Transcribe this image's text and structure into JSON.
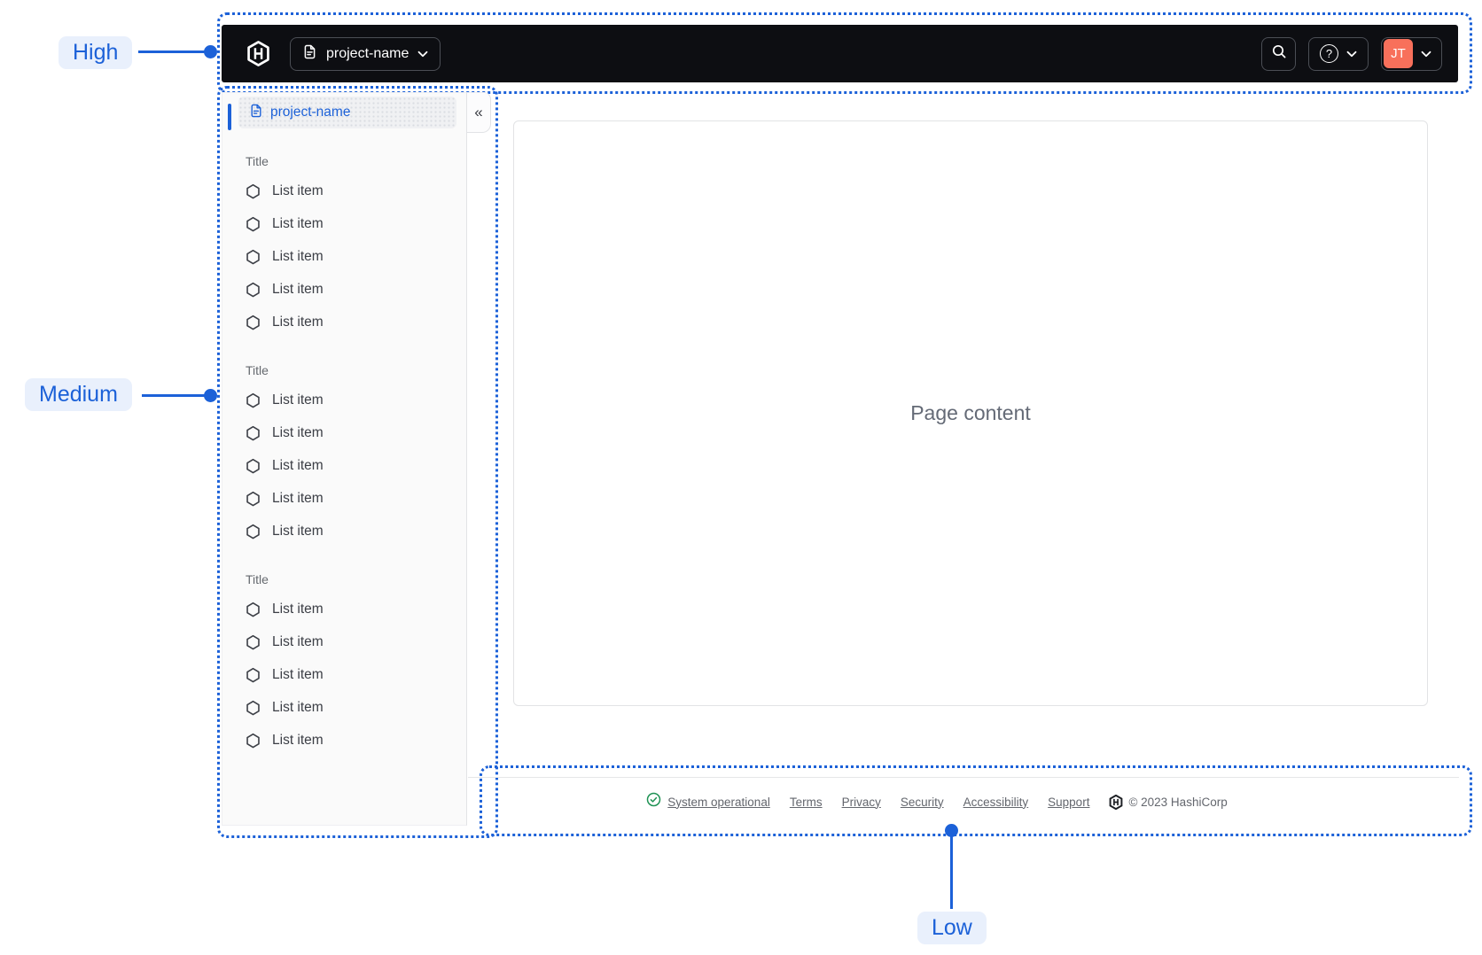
{
  "annotations": {
    "high_label": "High",
    "medium_label": "Medium",
    "low_label": "Low",
    "accent_color": "#1C61D8"
  },
  "navbar": {
    "logo_icon": "hashicorp-logo",
    "project_switcher": {
      "icon": "document",
      "label": "project-name",
      "chevron": "chevron-down"
    },
    "search_icon": "magnifier",
    "help": {
      "icon": "question-mark-circle",
      "glyph": "?",
      "chevron": "chevron-down"
    },
    "account": {
      "initials": "JT",
      "avatar_color": "#F8705B",
      "chevron": "chevron-down"
    },
    "background_color": "#0D0E12"
  },
  "sidebar": {
    "project": {
      "icon": "document",
      "label": "project-name"
    },
    "collapse_glyph": "«",
    "item_icon": "hexagon-outline",
    "sections": [
      {
        "title": "Title",
        "items": [
          "List item",
          "List item",
          "List item",
          "List item",
          "List item"
        ]
      },
      {
        "title": "Title",
        "items": [
          "List item",
          "List item",
          "List item",
          "List item",
          "List item"
        ]
      },
      {
        "title": "Title",
        "items": [
          "List item",
          "List item",
          "List item",
          "List item",
          "List item"
        ]
      }
    ]
  },
  "main": {
    "placeholder": "Page content"
  },
  "footer": {
    "status": {
      "icon": "check-circle",
      "label": "System operational",
      "color": "#1F9254"
    },
    "links": [
      "Terms",
      "Privacy",
      "Security",
      "Accessibility",
      "Support"
    ],
    "copyright": "© 2023 HashiCorp",
    "copyright_logo": "hashicorp-logo"
  }
}
